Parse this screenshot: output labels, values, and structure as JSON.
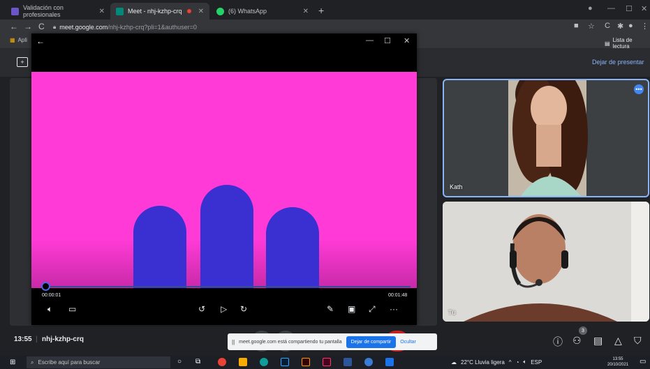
{
  "tabs": [
    {
      "title": "Validación con profesionales",
      "color": "#6b55c8"
    },
    {
      "title": "Meet - nhj-kzhp-crq",
      "color": "#00897b"
    },
    {
      "title": "(6) WhatsApp",
      "color": "#25d366"
    }
  ],
  "address": {
    "host": "meet.google.com",
    "path": "/nhj-kzhp-crq?pli=1&authuser=0"
  },
  "bookmarks": {
    "apps": "Apli",
    "reading_list": "Lista de lectura"
  },
  "meet": {
    "stop_presenting": "Dejar de presentar",
    "time": "13:55",
    "separator": "|",
    "code": "nhj-kzhp-crq",
    "participants_count": "3",
    "share_banner": {
      "text": "meet.google.com está compartiendo tu pantalla",
      "stop_label": "Dejar de compartir",
      "hide_label": "Ocultar"
    }
  },
  "tiles": [
    {
      "name": "Kath"
    },
    {
      "name": "Tú"
    }
  ],
  "player": {
    "current_time": "00:00:01",
    "duration": "00:01:48",
    "progress": 0.01,
    "video_colors": {
      "background": "#ff3ad6",
      "shape": "#3a2fd0"
    }
  },
  "taskbar": {
    "search_placeholder": "Escribe aquí para buscar",
    "weather": "22°C Lluvia ligera",
    "language": "ESP",
    "clock_time": "13:55",
    "clock_date": "20/10/2021"
  }
}
